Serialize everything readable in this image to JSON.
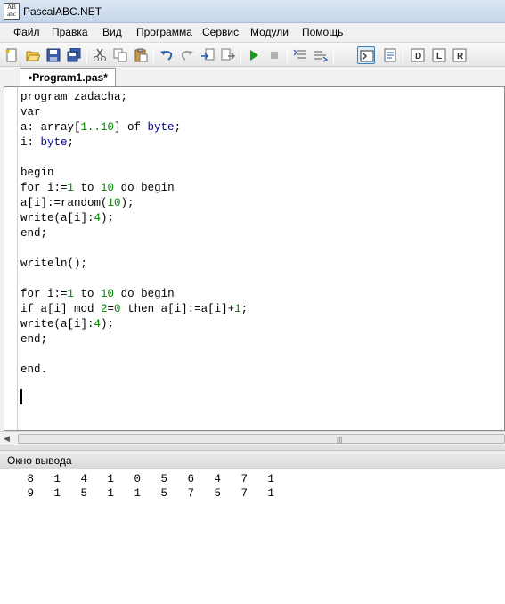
{
  "window": {
    "title": "PascalABC.NET",
    "icon_text": [
      "AB",
      "abc"
    ]
  },
  "menu": [
    "Файл",
    "Правка",
    "Вид",
    "Программа",
    "Сервис",
    "Модули",
    "Помощь"
  ],
  "toolbar": {
    "buttons": [
      "new-file-icon",
      "open-file-icon",
      "save-icon",
      "save-all-icon",
      "cut-icon",
      "copy-icon",
      "paste-icon",
      "undo-icon",
      "redo-icon",
      "step-into-icon",
      "step-over-icon",
      "run-icon",
      "stop-icon",
      "debug-list-icon",
      "debug-watch-icon",
      "output-window-icon",
      "properties-icon",
      "format-d-icon",
      "format-l-icon",
      "format-r-icon"
    ]
  },
  "tab": {
    "label": "•Program1.pas*"
  },
  "code_lines": [
    [
      {
        "t": "program zadacha;"
      }
    ],
    [
      {
        "t": "var"
      }
    ],
    [
      {
        "t": "a: array["
      },
      {
        "t": "1..10",
        "c": "num"
      },
      {
        "t": "] of "
      },
      {
        "t": "byte",
        "c": "typ"
      },
      {
        "t": ";"
      }
    ],
    [
      {
        "t": "i: "
      },
      {
        "t": "byte",
        "c": "typ"
      },
      {
        "t": ";"
      }
    ],
    [
      {
        "t": ""
      }
    ],
    [
      {
        "t": "begin"
      }
    ],
    [
      {
        "t": "for i:="
      },
      {
        "t": "1",
        "c": "num"
      },
      {
        "t": " to "
      },
      {
        "t": "10",
        "c": "num"
      },
      {
        "t": " do begin"
      }
    ],
    [
      {
        "t": "a[i]:=random("
      },
      {
        "t": "10",
        "c": "num"
      },
      {
        "t": ");"
      }
    ],
    [
      {
        "t": "write(a[i]:"
      },
      {
        "t": "4",
        "c": "num"
      },
      {
        "t": ");"
      }
    ],
    [
      {
        "t": "end;"
      }
    ],
    [
      {
        "t": ""
      }
    ],
    [
      {
        "t": "writeln();"
      }
    ],
    [
      {
        "t": ""
      }
    ],
    [
      {
        "t": "for i:="
      },
      {
        "t": "1",
        "c": "num"
      },
      {
        "t": " to "
      },
      {
        "t": "10",
        "c": "num"
      },
      {
        "t": " do begin"
      }
    ],
    [
      {
        "t": "if a[i] mod "
      },
      {
        "t": "2",
        "c": "num"
      },
      {
        "t": "="
      },
      {
        "t": "0",
        "c": "num"
      },
      {
        "t": " then a[i]:=a[i]+"
      },
      {
        "t": "1",
        "c": "num"
      },
      {
        "t": ";"
      }
    ],
    [
      {
        "t": "write(a[i]:"
      },
      {
        "t": "4",
        "c": "num"
      },
      {
        "t": ");"
      }
    ],
    [
      {
        "t": "end;"
      }
    ],
    [
      {
        "t": ""
      }
    ],
    [
      {
        "t": "end."
      }
    ]
  ],
  "output_panel": {
    "title": "Окно вывода",
    "lines": [
      "   8   1   4   1   0   5   6   4   7   1",
      "   9   1   5   1   1   5   7   5   7   1"
    ]
  },
  "colors": {
    "number": "#008000",
    "type": "#00009b",
    "run": "#1c9b1c"
  }
}
